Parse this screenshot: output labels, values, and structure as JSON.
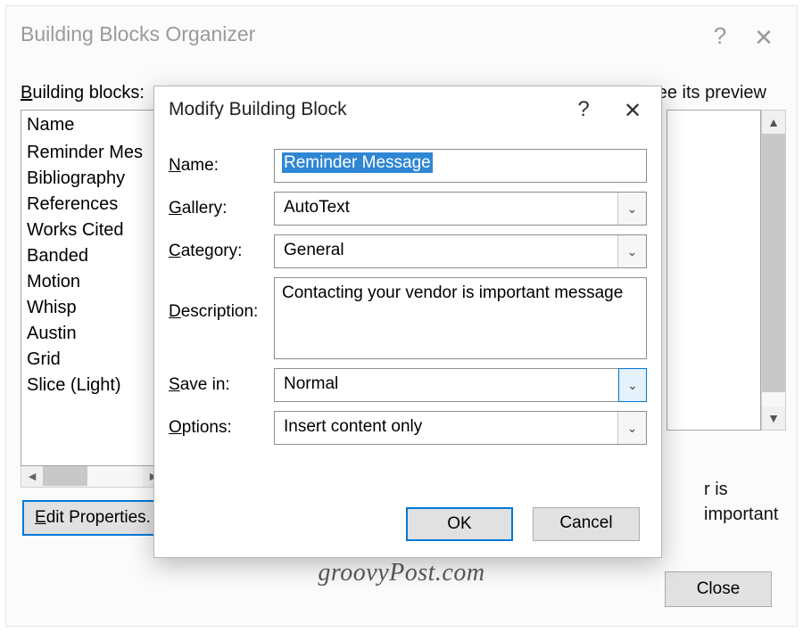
{
  "outer": {
    "title": "Building Blocks Organizer",
    "bb_label_pre": "B",
    "bb_label_post": "uilding blocks:",
    "preview_hint": "o see its preview",
    "list_header": "Name",
    "items": [
      "Reminder Mes",
      "Bibliography",
      "References",
      "Works Cited",
      "Banded",
      "Motion",
      "Whisp",
      "Austin",
      "Grid",
      "Slice (Light)"
    ],
    "edit_pre": "E",
    "edit_post": "dit Properties.",
    "preview_fragment": "r is important",
    "close_label": "Close"
  },
  "modal": {
    "title": "Modify Building Block",
    "name_label_u": "N",
    "name_label": "ame:",
    "name_value": "Reminder Message",
    "gallery_label_u": "G",
    "gallery_label": "allery:",
    "gallery_value": "AutoText",
    "category_label_u": "C",
    "category_label": "ategory:",
    "category_value": "General",
    "desc_label_u": "D",
    "desc_label": "escription:",
    "desc_value": "Contacting your vendor is important message",
    "savein_label_u": "S",
    "savein_label": "ave in:",
    "savein_value": "Normal",
    "options_label_u": "O",
    "options_label": "ptions:",
    "options_value": "Insert content only",
    "ok_label": "OK",
    "cancel_label": "Cancel"
  },
  "watermark": "groovyPost.com"
}
